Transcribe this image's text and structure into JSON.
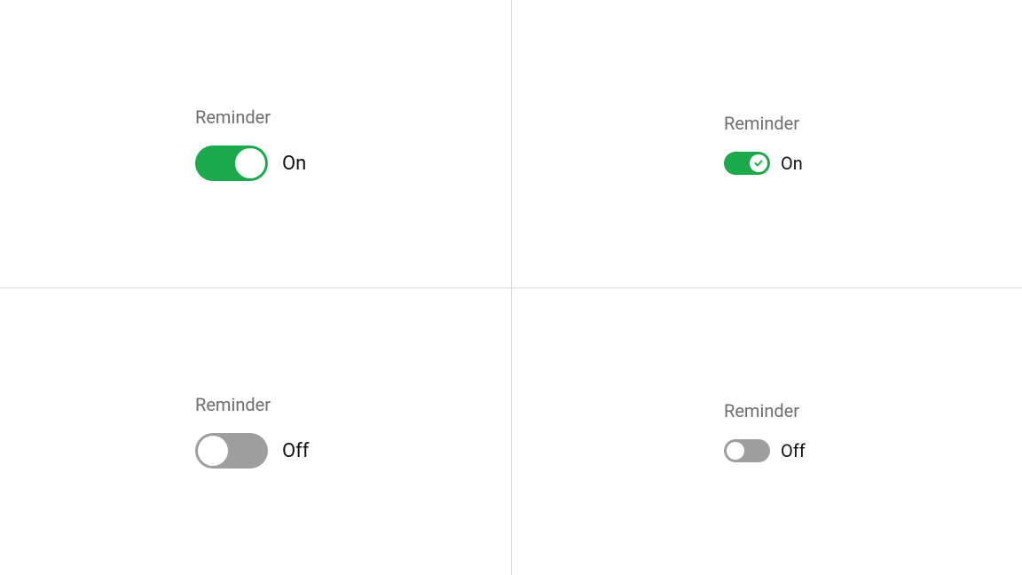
{
  "colors": {
    "toggle_on": "#1ba94c",
    "toggle_off": "#9e9e9e",
    "label": "#6e6e6e",
    "text": "#111111"
  },
  "toggles": {
    "large_on": {
      "label": "Reminder",
      "status": "On",
      "state": "on"
    },
    "small_on": {
      "label": "Reminder",
      "status": "On",
      "state": "on"
    },
    "large_off": {
      "label": "Reminder",
      "status": "Off",
      "state": "off"
    },
    "small_off": {
      "label": "Reminder",
      "status": "Off",
      "state": "off"
    }
  }
}
